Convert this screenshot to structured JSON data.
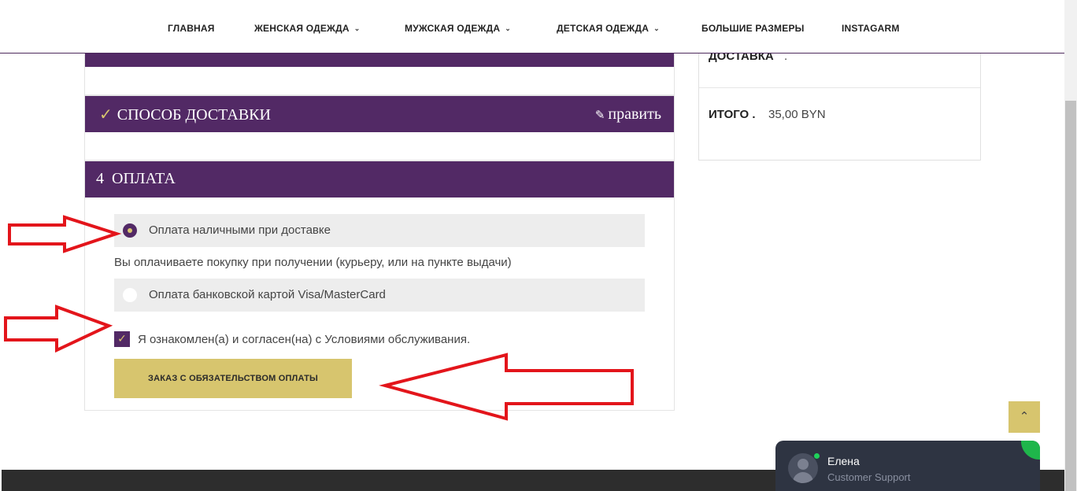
{
  "nav": {
    "items": [
      {
        "label": "ГЛАВНАЯ",
        "dropdown": false
      },
      {
        "label": "ЖЕНСКАЯ ОДЕЖДА",
        "dropdown": true
      },
      {
        "label": "МУЖСКАЯ ОДЕЖДА",
        "dropdown": true
      },
      {
        "label": "ДЕТСКАЯ ОДЕЖДА",
        "dropdown": true
      },
      {
        "label": "БОЛЬШИЕ РАЗМЕРЫ",
        "dropdown": false
      },
      {
        "label": "INSTAGARM",
        "dropdown": false
      }
    ]
  },
  "checkout": {
    "delivery_step": {
      "title": "СПОСОБ ДОСТАВКИ",
      "edit_label": "править"
    },
    "payment_step": {
      "number": "4",
      "title": "ОПЛАТА"
    },
    "payment_options": [
      {
        "label": "Оплата наличными при доставке",
        "selected": true
      },
      {
        "label": "Оплата банковской картой Visa/MasterCard",
        "selected": false
      }
    ],
    "cash_description": "Вы оплачиваете покупку при получении (курьеру, или на пункте выдачи)",
    "terms_label": "Я ознакомлен(а) и согласен(на) с Условиями обслуживания.",
    "terms_checked": true,
    "order_button": "ЗАКАЗ С ОБЯЗАТЕЛЬСТВОМ ОПЛАТЫ"
  },
  "summary": {
    "delivery_label": "ДОСТАВКА",
    "delivery_value": ".",
    "total_label": "ИТОГО .",
    "total_value": "35,00 BYN"
  },
  "chat": {
    "agent_name": "Елена",
    "agent_role": "Customer Support"
  },
  "colors": {
    "brand_purple": "#522965",
    "gold": "#d7c56e",
    "annotation_red": "#e3151b"
  }
}
